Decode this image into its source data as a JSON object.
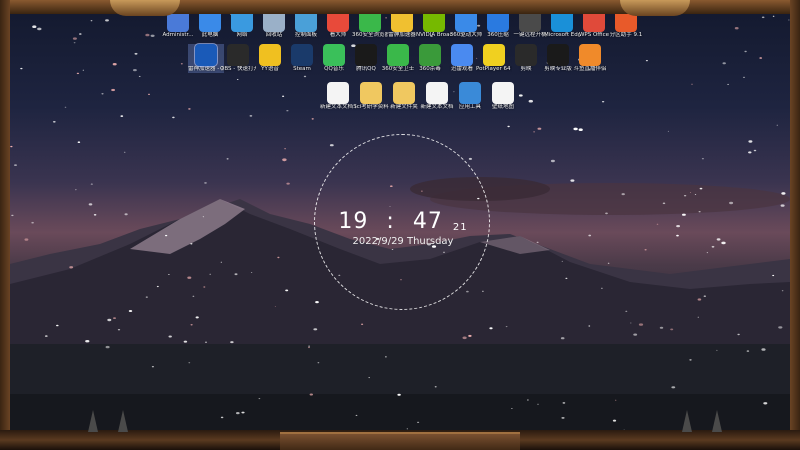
{
  "desktop": {
    "top_row_icons": [
      {
        "label": "Administr...",
        "color": "#4a7ad8"
      },
      {
        "label": "此电脑",
        "color": "#3a8ae8"
      },
      {
        "label": "网络",
        "color": "#3a9ae0"
      },
      {
        "label": "回收站",
        "color": "#9ab0c8"
      },
      {
        "label": "控制面板",
        "color": "#4aa0d8"
      },
      {
        "label": "看大师",
        "color": "#e84a3a"
      },
      {
        "label": "360安全浏览器",
        "color": "#3ab84a"
      },
      {
        "label": "雷神加速器",
        "color": "#f0c030"
      },
      {
        "label": "NVIDIA Broadcast",
        "color": "#76b900"
      },
      {
        "label": "360驱动大师",
        "color": "#3a8ae8"
      },
      {
        "label": "360压缩",
        "color": "#2a7ae0"
      },
      {
        "label": "一键远程开机",
        "color": "#4a4a4a"
      },
      {
        "label": "Microsoft Edge",
        "color": "#1a90d8"
      },
      {
        "label": "WPS Office",
        "color": "#e04a3a"
      },
      {
        "label": "分区助手 9.1",
        "color": "#e85a2a"
      }
    ],
    "second_row_icons": [
      {
        "label": "雷神加速器 - 打开所有",
        "color": "#1a5ab8",
        "selected": true
      },
      {
        "label": "OBS - 快速打开",
        "color": "#2a2a2a"
      },
      {
        "label": "YY语音",
        "color": "#f0c020"
      },
      {
        "label": "Steam",
        "color": "#1a3a6a"
      },
      {
        "label": "QQ音乐",
        "color": "#3ac05a"
      },
      {
        "label": "腾讯QQ",
        "color": "#1a1a1a"
      },
      {
        "label": "360安全卫士",
        "color": "#3ab84a"
      },
      {
        "label": "360杀毒",
        "color": "#3a9a3a"
      },
      {
        "label": "迅雷观看",
        "color": "#4a8af0"
      },
      {
        "label": "PotPlayer 64 bit",
        "color": "#f0d020"
      },
      {
        "label": "剪映",
        "color": "#2a2a2a"
      },
      {
        "label": "剪映专业版",
        "color": "#1a1a1a"
      },
      {
        "label": "斗鱼直播伴侣",
        "color": "#f08a2a"
      }
    ],
    "third_row_icons": [
      {
        "label": "新建文本文档 (2)",
        "color": "#f4f4f4"
      },
      {
        "label": "Sci考研学资料",
        "color": "#f0c860"
      },
      {
        "label": "新建文件夹",
        "color": "#f0c860"
      },
      {
        "label": "新建文本文档",
        "color": "#f4f4f4"
      },
      {
        "label": "应用工具",
        "color": "#3a8ad8"
      },
      {
        "label": "壁纸地图",
        "color": "#f4f4f4"
      }
    ]
  },
  "clock": {
    "hours": "19",
    "minutes": "47",
    "seconds": "21",
    "date": "2022/9/29 Thursday"
  }
}
